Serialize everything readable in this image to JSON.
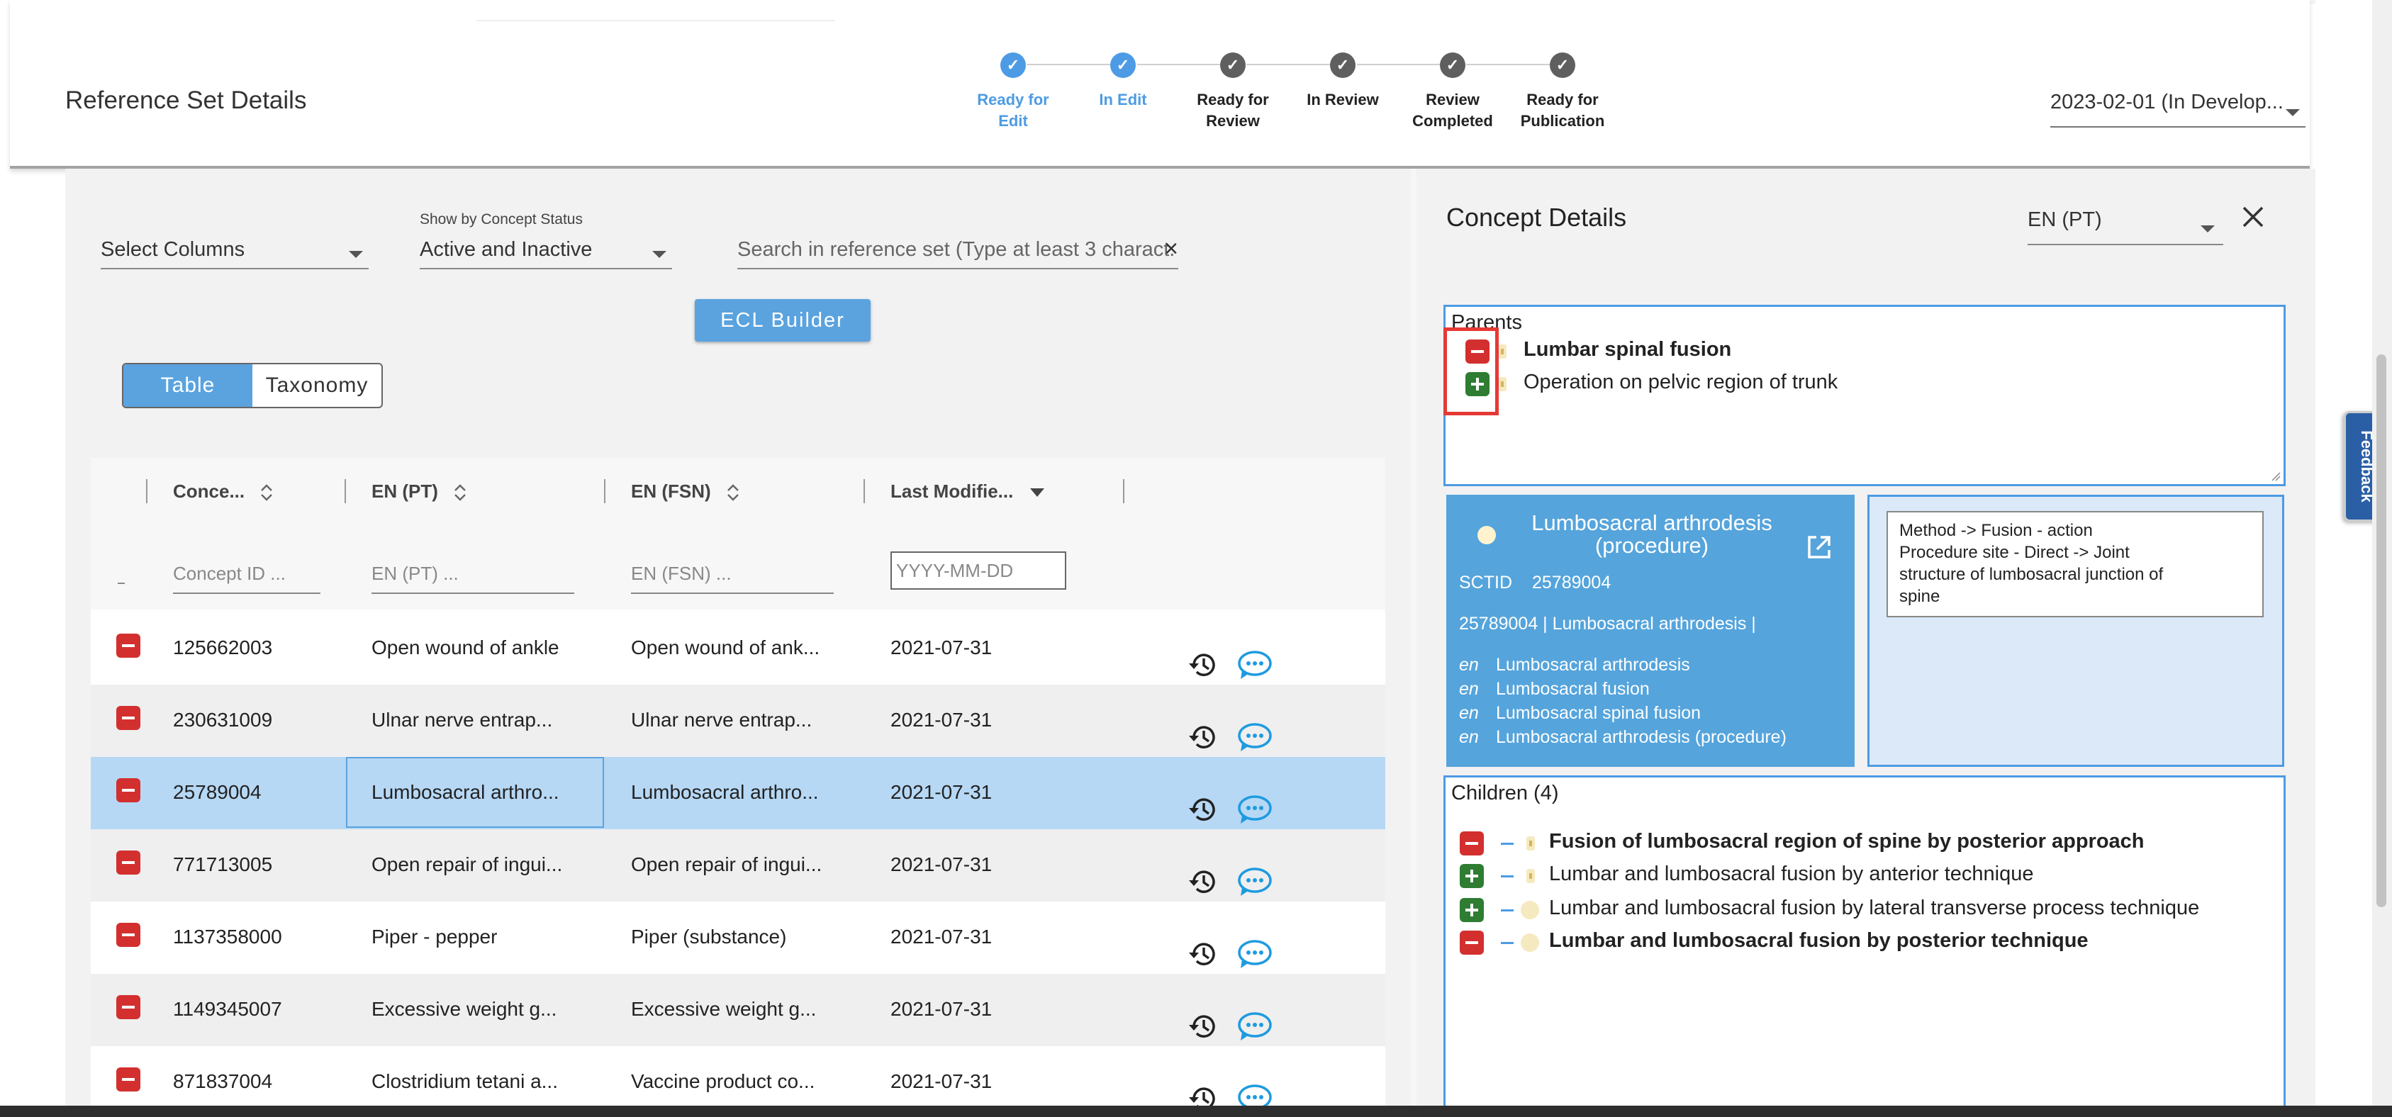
{
  "header": {
    "title": "Reference Set Details",
    "version": "2023-02-01 (In Develop...",
    "steps": [
      {
        "label_line1": "Ready for",
        "label_line2": "Edit",
        "status": "done"
      },
      {
        "label_line1": "In Edit",
        "label_line2": "",
        "status": "done"
      },
      {
        "label_line1": "Ready for",
        "label_line2": "Review",
        "status": "todo"
      },
      {
        "label_line1": "In Review",
        "label_line2": "",
        "status": "todo"
      },
      {
        "label_line1": "Review",
        "label_line2": "Completed",
        "status": "todo"
      },
      {
        "label_line1": "Ready for",
        "label_line2": "Publication",
        "status": "todo"
      }
    ]
  },
  "filters": {
    "select_columns": "Select Columns",
    "status_label": "Show by Concept Status",
    "status_value": "Active and Inactive",
    "search_placeholder": "Search in reference set (Type at least 3 charact.",
    "ecl_button": "ECL Builder",
    "view_table": "Table",
    "view_taxonomy": "Taxonomy"
  },
  "grid": {
    "columns": [
      "Conce...",
      "EN (PT)",
      "EN (FSN)",
      "Last Modifie..."
    ],
    "filter_placeholders": [
      "Concept ID ...",
      "EN (PT) ...",
      "EN (FSN) ...",
      "YYYY-MM-DD"
    ],
    "rows": [
      {
        "id": "125662003",
        "pt": "Open wound of ankle",
        "fsn": "Open wound of ank...",
        "date": "2021-07-31"
      },
      {
        "id": "230631009",
        "pt": "Ulnar nerve entrap...",
        "fsn": "Ulnar nerve entrap...",
        "date": "2021-07-31"
      },
      {
        "id": "25789004",
        "pt": "Lumbosacral arthro...",
        "fsn": "Lumbosacral arthro...",
        "date": "2021-07-31"
      },
      {
        "id": "771713005",
        "pt": "Open repair of ingui...",
        "fsn": "Open repair of ingui...",
        "date": "2021-07-31"
      },
      {
        "id": "1137358000",
        "pt": "Piper - pepper",
        "fsn": "Piper (substance)",
        "date": "2021-07-31"
      },
      {
        "id": "1149345007",
        "pt": "Excessive weight g...",
        "fsn": "Excessive weight g...",
        "date": "2021-07-31"
      },
      {
        "id": "871837004",
        "pt": "Clostridium tetani a...",
        "fsn": "Vaccine product co...",
        "date": "2021-07-31"
      }
    ]
  },
  "concept_details": {
    "title": "Concept Details",
    "language": "EN (PT)",
    "parents_title": "Parents",
    "parents": [
      {
        "label": "Lumbar spinal fusion",
        "action": "minus",
        "bold": true
      },
      {
        "label": "Operation on pelvic region of trunk",
        "action": "plus",
        "bold": false
      }
    ],
    "card": {
      "title_line1": "Lumbosacral arthrodesis",
      "title_line2": "(procedure)",
      "sctid_label": "SCTID",
      "sctid_value": "25789004",
      "fsn_line": "25789004 | Lumbosacral arthrodesis |",
      "lang_tag": "en",
      "descriptions": [
        "Lumbosacral arthrodesis",
        "Lumbosacral fusion",
        "Lumbosacral spinal fusion",
        "Lumbosacral arthrodesis (procedure)"
      ]
    },
    "attributes": [
      "Method -> Fusion - action",
      "Procedure site - Direct -> Joint",
      "structure of lumbosacral junction of",
      "spine"
    ],
    "children_title": "Children (4)",
    "children": [
      {
        "label": "Fusion of lumbosacral region of spine by posterior approach",
        "action": "minus",
        "bold": true,
        "icon": "primitive"
      },
      {
        "label": "Lumbar and lumbosacral fusion by anterior technique",
        "action": "plus",
        "bold": false,
        "icon": "primitive"
      },
      {
        "label": "Lumbar and lumbosacral fusion by lateral transverse process technique",
        "action": "plus",
        "bold": false,
        "icon": "defined"
      },
      {
        "label": "Lumbar and lumbosacral fusion by posterior technique",
        "action": "minus",
        "bold": true,
        "icon": "defined"
      }
    ]
  },
  "feedback": "Feedback",
  "colors": {
    "accent": "#4d9be4",
    "remove": "#d32f2f",
    "add": "#2e7d32",
    "selected_row": "#b6d8f5"
  }
}
